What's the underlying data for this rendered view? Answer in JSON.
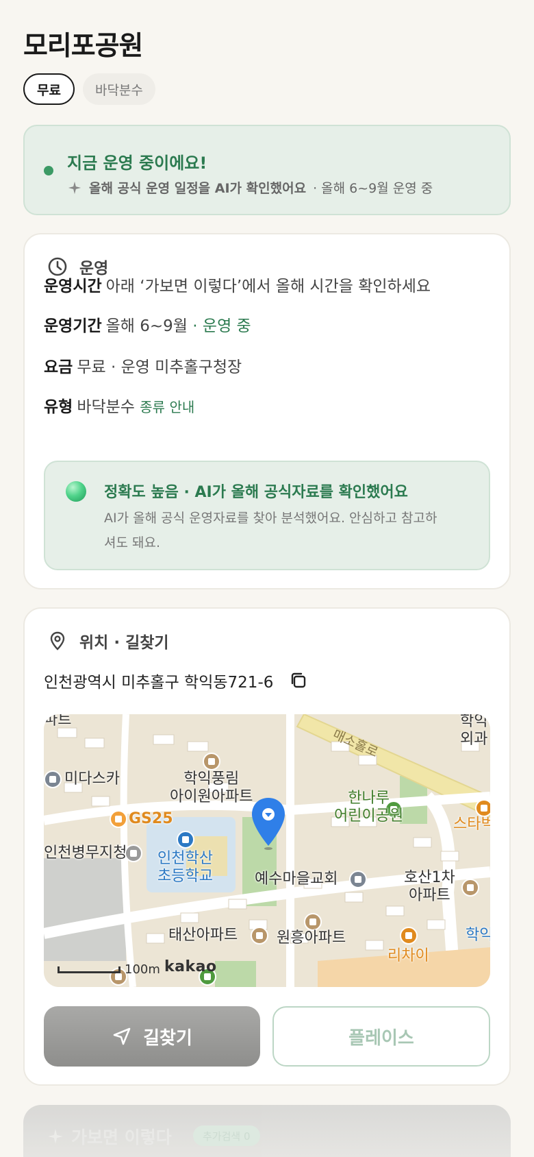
{
  "title": "모리포공원",
  "chips": [
    {
      "label": "무료",
      "active": true
    },
    {
      "label": "바닥분수",
      "active": false
    }
  ],
  "status": {
    "title": "지금 운영 중이에요!",
    "sub_bold": "올해 공식 운영 일정을 AI가 확인했어요",
    "sub_rest": "· 올해 6~9월 운영 중"
  },
  "operation": {
    "header": "운영",
    "hours_label": "운영시간",
    "hours_value": "아래 ‘가보면 이렇다’에서 올해 시간을 확인하세요",
    "period_label": "운영기간",
    "period_value": "올해 6~9월",
    "period_status": "· 운영 중",
    "fee_label": "요금",
    "fee_value": "무료 · 운영 미추홀구청장",
    "type_label": "유형",
    "type_value": "바닥분수",
    "type_link": "종류 안내",
    "accuracy_title": "정확도 높음 · AI가 올해 공식자료를 확인했어요",
    "accuracy_desc": "AI가 올해 공식 운영자료를 찾아 분석했어요. 안심하고 참고하셔도 돼요."
  },
  "location": {
    "header": "위치 · 길찾기",
    "address": "인천광역시 미추홀구 학익동721-6",
    "map_labels": {
      "road": "매소홀로",
      "apt_top": "파트",
      "hospital": "학익\n외과",
      "midas": "미다스카",
      "hakik": "학익풍림\n아이원아파트",
      "hannaru": "한나루\n어린이공원",
      "starbucks": "스타벅",
      "gs25": "GS25",
      "army": "인천병무지청",
      "school": "인천학산\n초등학교",
      "church": "예수마을교회",
      "hosan": "호산1차\n아파트",
      "taesan": "태산아파트",
      "wonheung": "원흥아파트",
      "richai": "리차이",
      "hak_right": "학익",
      "scale": "100m",
      "brand": "kakao"
    },
    "route_button": "길찾기",
    "place_button": "플레이스"
  },
  "peek": {
    "title": "가보면 이렇다",
    "badge": "추가검색 0"
  },
  "colors": {
    "accent_green": "#2b7a4f",
    "status_bg": "#e6efe8",
    "page_bg": "#f8f6f1"
  }
}
